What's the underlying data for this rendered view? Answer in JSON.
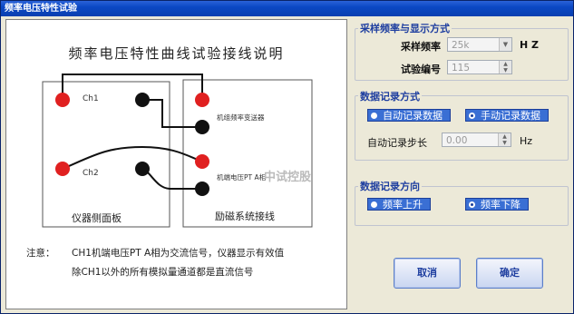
{
  "window": {
    "title": "频率电压特性试验"
  },
  "diagram": {
    "title": "频率电压特性曲线试验接线说明",
    "ch1": "Ch1",
    "ch2": "Ch2",
    "top_converter": "机组频率变送器",
    "pt_label": "机端电压PT A相",
    "left_caption": "仪器侧面板",
    "right_caption": "励磁系统接线",
    "note_label": "注意：",
    "note_line1": "CH1机端电压PT A相为交流信号，仪器显示有效值",
    "note_line2": "除CH1以外的所有模拟量通道都是直流信号",
    "watermark": "中试控股"
  },
  "sampling": {
    "group_title": "采样频率与显示方式",
    "rate_label": "采样频率",
    "rate_value": "25k",
    "rate_unit": "H Z",
    "test_no_label": "试验编号",
    "test_no_value": "115"
  },
  "record_mode": {
    "group_title": "数据记录方式",
    "auto_label": "自动记录数据",
    "manual_label": "手动记录数据",
    "step_label": "自动记录步长",
    "step_value": "0.00",
    "step_unit": "Hz"
  },
  "record_direction": {
    "group_title": "数据记录方向",
    "up_label": "频率上升",
    "down_label": "频率下降"
  },
  "buttons": {
    "cancel": "取消",
    "ok": "确定"
  },
  "colors": {
    "terminal_red": "#e02020",
    "terminal_black": "#111111",
    "accent": "#1f3fa0"
  }
}
